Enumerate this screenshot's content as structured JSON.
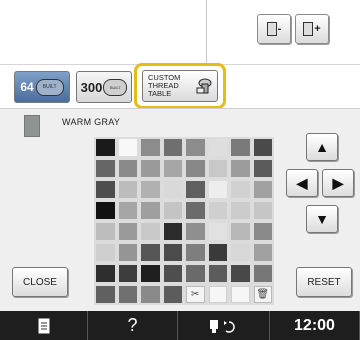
{
  "toolbar": {
    "spool_minus_label": "-",
    "spool_plus_label": "+"
  },
  "tabs": {
    "tab_64_label": "64",
    "tab_64_sub": "BUILT",
    "tab_300_label": "300",
    "tab_300_sub": "BUILT",
    "custom_lines": [
      "CUSTOM",
      "THREAD",
      "TABLE"
    ]
  },
  "selected_color": {
    "name": "WARM GRAY",
    "swatch": "#8e948e"
  },
  "palette": [
    [
      "#1a1a1a",
      "#f8f8f8",
      "#8c8c8c",
      "#6f6f6f",
      "#8c8c8c",
      "#dedede",
      "#7a7a7a",
      "#4a4a4a"
    ],
    [
      "#666666",
      "#8a8a8a",
      "#9a9a9a",
      "#a5a5a5",
      "#878787",
      "#c8c8c8",
      "#9c9c9c",
      "#5a5a5a"
    ],
    [
      "#4d4d4d",
      "#bcbcbc",
      "#b1b1b1",
      "#d9d9d9",
      "#5f5f5f",
      "#ededed",
      "#d1d1d1",
      "#a0a0a0"
    ],
    [
      "#111111",
      "#a6a6a6",
      "#9f9f9f",
      "#c4c4c4",
      "#6b6b6b",
      "#cfcfcf",
      "#cccccc",
      "#c6c6c6"
    ],
    [
      "#bdbdbd",
      "#9a9a9a",
      "#c9c9c9",
      "#2c2c2c",
      "#8f8f8f",
      "#e1e1e1",
      "#b8b8b8",
      "#8a8a8a"
    ],
    [
      "#cfcfcf",
      "#959595",
      "#555555",
      "#4b4b4b",
      "#7e7e7e",
      "#3a3a3a",
      "#d7d7d7",
      "#a1a1a1"
    ],
    [
      "#2e2e2e",
      "#3c3c3c",
      "#1e1e1e",
      "#4e4e4e",
      "#6a6a6a",
      "#5c5c5c",
      "#484848",
      "#777777"
    ],
    [
      "#606060",
      "#707070",
      "#8a8a8a",
      "#5c5c5c",
      "#tool-scissors",
      "#empty",
      "#empty",
      "#tool-delete"
    ]
  ],
  "tool_icons": {
    "scissors": "✂",
    "delete": "🗑"
  },
  "buttons": {
    "close_label": "CLOSE",
    "reset_label": "RESET"
  },
  "arrows": {
    "up": "▲",
    "down": "▼",
    "left": "◀",
    "right": "▶"
  },
  "status": {
    "help": "?",
    "time": "12:00"
  }
}
